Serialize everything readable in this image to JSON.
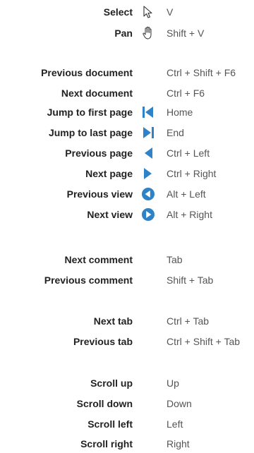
{
  "shortcuts": [
    {
      "label": "Select",
      "key": "V",
      "icon": "select-arrow-icon"
    },
    {
      "label": "Pan",
      "key": "Shift + V",
      "icon": "pan-hand-icon"
    },
    {
      "label": "Previous document",
      "key": "Ctrl + Shift + F6",
      "icon": ""
    },
    {
      "label": "Next document",
      "key": "Ctrl + F6",
      "icon": ""
    },
    {
      "label": "Jump to first page",
      "key": "Home",
      "icon": "first-page-icon"
    },
    {
      "label": "Jump to last page",
      "key": "End",
      "icon": "last-page-icon"
    },
    {
      "label": "Previous page",
      "key": "Ctrl + Left",
      "icon": "previous-page-icon"
    },
    {
      "label": "Next page",
      "key": "Ctrl + Right",
      "icon": "next-page-icon"
    },
    {
      "label": "Previous view",
      "key": "Alt + Left",
      "icon": "previous-view-icon"
    },
    {
      "label": "Next view",
      "key": "Alt + Right",
      "icon": "next-view-icon"
    },
    {
      "label": "Next comment",
      "key": "Tab",
      "icon": ""
    },
    {
      "label": "Previous comment",
      "key": "Shift + Tab",
      "icon": ""
    },
    {
      "label": "Next tab",
      "key": "Ctrl + Tab",
      "icon": ""
    },
    {
      "label": "Previous tab",
      "key": "Ctrl + Shift + Tab",
      "icon": ""
    },
    {
      "label": "Scroll up",
      "key": "Up",
      "icon": ""
    },
    {
      "label": "Scroll down",
      "key": "Down",
      "icon": ""
    },
    {
      "label": "Scroll left",
      "key": "Left",
      "icon": ""
    },
    {
      "label": "Scroll right",
      "key": "Right",
      "icon": ""
    }
  ],
  "colors": {
    "accent": "#2e82c8",
    "label": "#222222",
    "key": "#555555"
  }
}
